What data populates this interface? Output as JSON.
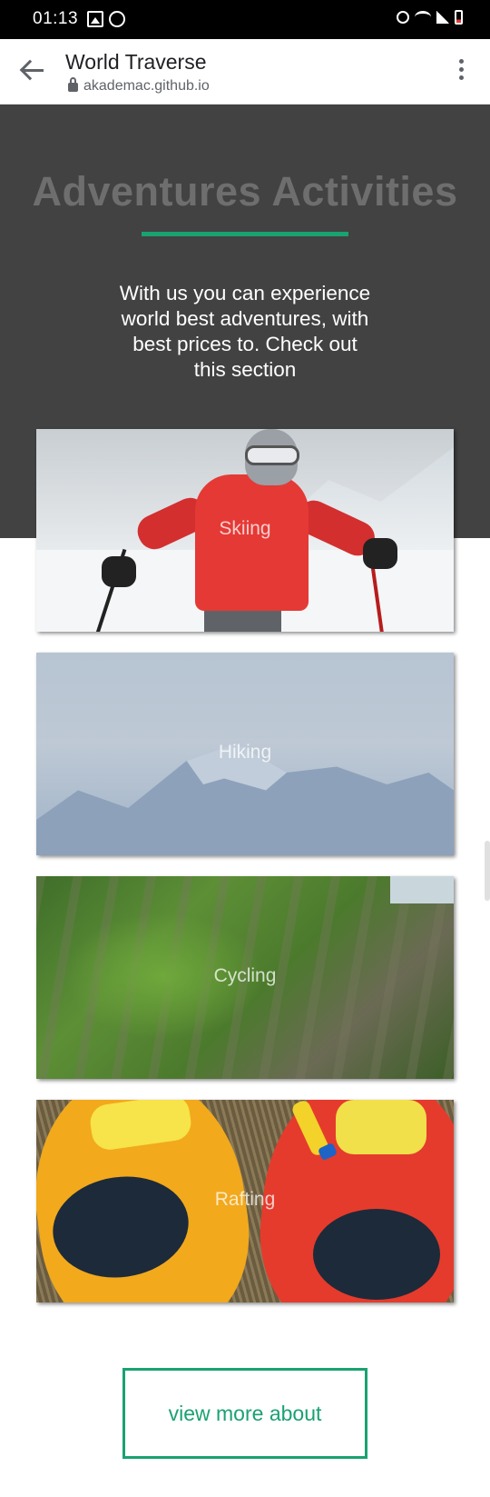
{
  "status_bar": {
    "time": "01:13"
  },
  "browser": {
    "title": "World Traverse",
    "url": "akademac.github.io"
  },
  "hero": {
    "heading": "Adventures Activities",
    "text": "With us you can experience world best adventures, with best prices to. Check out this section"
  },
  "activities": [
    {
      "label": "Skiing"
    },
    {
      "label": "Hiking"
    },
    {
      "label": "Cycling"
    },
    {
      "label": "Rafting"
    }
  ],
  "button": {
    "label": "view more about"
  },
  "colors": {
    "accent": "#1aa271",
    "hero_bg": "#424242",
    "heading": "#6e6e6e"
  },
  "icons": [
    "image-icon",
    "messenger-icon",
    "alarm-icon",
    "wifi-icon",
    "signal-icon",
    "battery-icon",
    "back-arrow-icon",
    "lock-icon",
    "more-vert-icon"
  ]
}
